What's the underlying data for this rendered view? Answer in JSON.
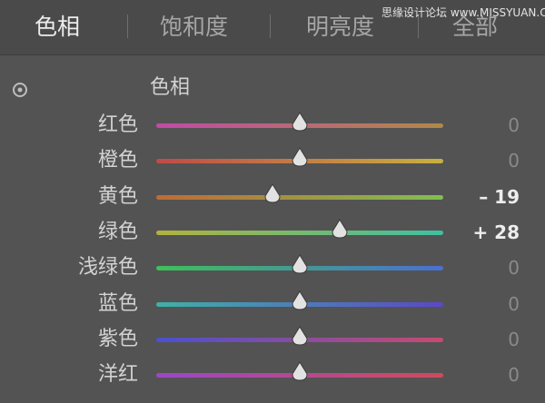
{
  "tabs": [
    {
      "label": "色相",
      "active": true
    },
    {
      "label": "饱和度",
      "active": false
    },
    {
      "label": "明亮度",
      "active": false
    },
    {
      "label": "全部",
      "active": false
    }
  ],
  "watermark": "思缘设计论坛 www.MISSYUAN.COM",
  "section": {
    "title": "色相",
    "target_icon": "target-adjustment-icon"
  },
  "sliders": [
    {
      "label": "红色",
      "value": 0,
      "display": "0",
      "colors": [
        "#c24aa6",
        "#b08848"
      ]
    },
    {
      "label": "橙色",
      "value": 0,
      "display": "0",
      "colors": [
        "#c04a48",
        "#c8b040"
      ]
    },
    {
      "label": "黄色",
      "value": -19,
      "display": "– 19",
      "colors": [
        "#c06a34",
        "#80c050"
      ]
    },
    {
      "label": "绿色",
      "value": 28,
      "display": "+ 28",
      "colors": [
        "#b2b23e",
        "#3ec0a2"
      ]
    },
    {
      "label": "浅绿色",
      "value": 0,
      "display": "0",
      "colors": [
        "#3ec05a",
        "#4a70d0"
      ]
    },
    {
      "label": "蓝色",
      "value": 0,
      "display": "0",
      "colors": [
        "#3eb2a8",
        "#5a48c8"
      ]
    },
    {
      "label": "紫色",
      "value": 0,
      "display": "0",
      "colors": [
        "#4a50d0",
        "#c84a70"
      ]
    },
    {
      "label": "洋红",
      "value": 0,
      "display": "0",
      "colors": [
        "#9a48c8",
        "#d04a5a"
      ]
    }
  ],
  "slider_range": [
    -100,
    100
  ]
}
